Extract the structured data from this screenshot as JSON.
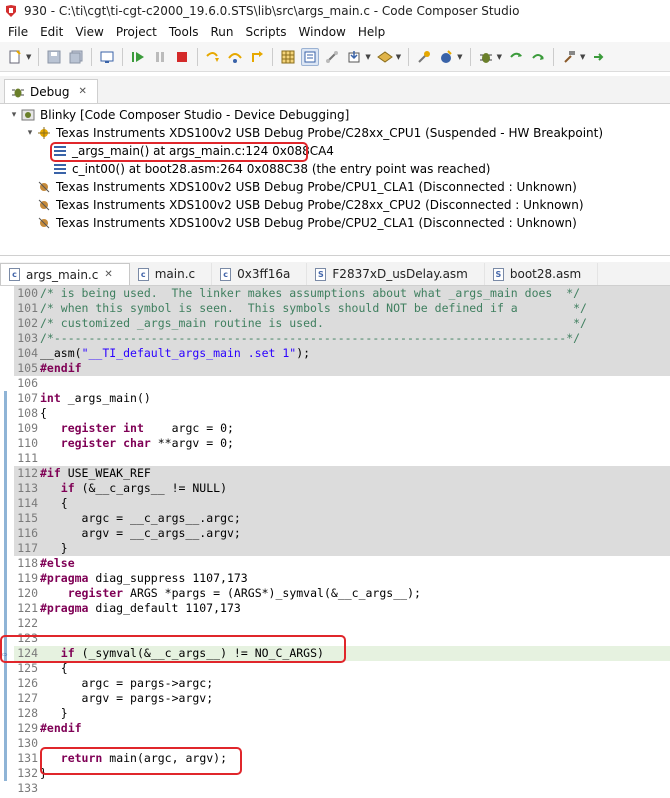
{
  "window": {
    "title": "930 - C:\\ti\\cgt\\ti-cgt-c2000_19.6.0.STS\\lib\\src\\args_main.c - Code Composer Studio"
  },
  "menu": [
    "File",
    "Edit",
    "View",
    "Project",
    "Tools",
    "Run",
    "Scripts",
    "Window",
    "Help"
  ],
  "debug_view": {
    "tab_label": "Debug",
    "tree": [
      {
        "label": "Blinky [Code Composer Studio - Device Debugging]"
      },
      {
        "label": "Texas Instruments XDS100v2 USB Debug Probe/C28xx_CPU1 (Suspended - HW Breakpoint)"
      },
      {
        "label": "_args_main() at args_main.c:124 0x088CA4"
      },
      {
        "label": "c_int00() at boot28.asm:264 0x088C38  (the entry point was reached)"
      },
      {
        "label": "Texas Instruments XDS100v2 USB Debug Probe/CPU1_CLA1 (Disconnected : Unknown)"
      },
      {
        "label": "Texas Instruments XDS100v2 USB Debug Probe/C28xx_CPU2 (Disconnected : Unknown)"
      },
      {
        "label": "Texas Instruments XDS100v2 USB Debug Probe/CPU2_CLA1 (Disconnected : Unknown)"
      }
    ]
  },
  "editor": {
    "tabs": [
      {
        "label": "args_main.c",
        "icon": "c-file-icon"
      },
      {
        "label": "main.c",
        "icon": "c-file-icon"
      },
      {
        "label": "0x3ff16a",
        "icon": "c-file-icon"
      },
      {
        "label": "F2837xD_usDelay.asm",
        "icon": "asm-file-icon"
      },
      {
        "label": "boot28.asm",
        "icon": "asm-file-icon"
      }
    ],
    "lines": [
      {
        "n": "100",
        "text": "/* is being used.  The linker makes assumptions about what _args_main does  */"
      },
      {
        "n": "101",
        "text": "/* when this symbol is seen.  This symbols should NOT be defined if a        */"
      },
      {
        "n": "102",
        "text": "/* customized _args_main routine is used.                                    */"
      },
      {
        "n": "103",
        "text": "/*--------------------------------------------------------------------------*/"
      },
      {
        "n": "104",
        "text": "__asm(\"__TI_default_args_main .set 1\");"
      },
      {
        "n": "105",
        "text": "#endif"
      },
      {
        "n": "106",
        "text": ""
      },
      {
        "n": "107",
        "text": "int _args_main()"
      },
      {
        "n": "108",
        "text": "{"
      },
      {
        "n": "109",
        "text": "   register int    argc = 0;"
      },
      {
        "n": "110",
        "text": "   register char **argv = 0;"
      },
      {
        "n": "111",
        "text": ""
      },
      {
        "n": "112",
        "text": "#if USE_WEAK_REF"
      },
      {
        "n": "113",
        "text": "   if (&__c_args__ != NULL)"
      },
      {
        "n": "114",
        "text": "   {"
      },
      {
        "n": "115",
        "text": "      argc = __c_args__.argc;"
      },
      {
        "n": "116",
        "text": "      argv = __c_args__.argv;"
      },
      {
        "n": "117",
        "text": "   }"
      },
      {
        "n": "118",
        "text": "#else"
      },
      {
        "n": "119",
        "text": "#pragma diag_suppress 1107,173"
      },
      {
        "n": "120",
        "text": "    register ARGS *pargs = (ARGS*)_symval(&__c_args__);"
      },
      {
        "n": "121",
        "text": "#pragma diag_default 1107,173"
      },
      {
        "n": "122",
        "text": ""
      },
      {
        "n": "123",
        "text": ""
      },
      {
        "n": "124",
        "text": "   if (_symval(&__c_args__) != NO_C_ARGS)"
      },
      {
        "n": "125",
        "text": "   {"
      },
      {
        "n": "126",
        "text": "      argc = pargs->argc;"
      },
      {
        "n": "127",
        "text": "      argv = pargs->argv;"
      },
      {
        "n": "128",
        "text": "   }"
      },
      {
        "n": "129",
        "text": "#endif"
      },
      {
        "n": "130",
        "text": ""
      },
      {
        "n": "131",
        "text": "   return main(argc, argv);"
      },
      {
        "n": "132",
        "text": "}"
      },
      {
        "n": "133",
        "text": ""
      }
    ]
  },
  "colors": {
    "highlight_box": "#e0262b",
    "inactive_code_bg": "#dcdcdc",
    "current_line_bg": "#e6f2e0",
    "keyword": "#7f0055",
    "comment": "#3f7f5f",
    "string": "#2a00ff"
  }
}
